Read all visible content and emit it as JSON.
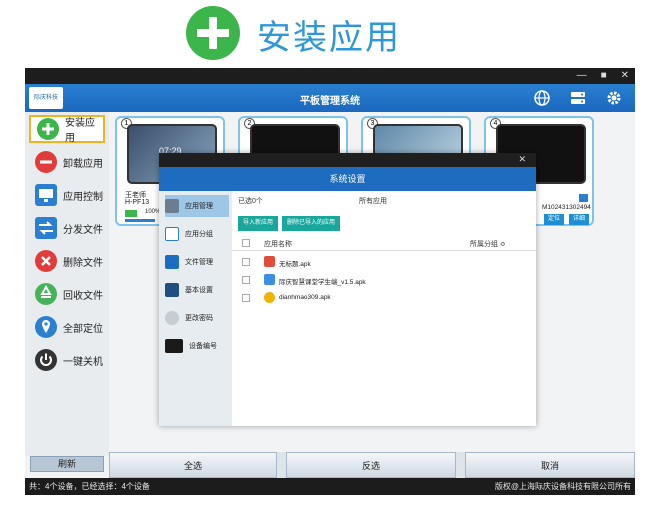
{
  "banner": {
    "title": "安装应用"
  },
  "app": {
    "title": "平板管理系统",
    "icons": [
      "globe-icon",
      "server-icon",
      "gear-icon"
    ]
  },
  "sidebar": {
    "items": [
      {
        "label": "安装应用",
        "icon": "plus-circle-icon",
        "color": "#3cb64a"
      },
      {
        "label": "卸载应用",
        "icon": "minus-circle-icon",
        "color": "#e23b3b"
      },
      {
        "label": "应用控制",
        "icon": "monitor-icon",
        "color": "#2a7fd0"
      },
      {
        "label": "分发文件",
        "icon": "transfer-icon",
        "color": "#2a7fd0"
      },
      {
        "label": "删除文件",
        "icon": "x-circle-icon",
        "color": "#e23b3b"
      },
      {
        "label": "回收文件",
        "icon": "recycle-icon",
        "color": "#46b35a"
      },
      {
        "label": "全部定位",
        "icon": "location-icon",
        "color": "#2a7fd0"
      },
      {
        "label": "一键关机",
        "icon": "power-icon",
        "color": "#333333"
      }
    ],
    "refresh": "刷新"
  },
  "devices": [
    {
      "num": "1",
      "user": "王老师",
      "model": "H-PF13",
      "battery": "100%",
      "time": "07:29"
    },
    {
      "num": "2"
    },
    {
      "num": "3"
    },
    {
      "num": "4",
      "serial": "M102431302494",
      "locate": "定位",
      "detail": "详细"
    }
  ],
  "bottom": {
    "select_all": "全选",
    "invert": "反选",
    "cancel": "取消"
  },
  "status": {
    "left": "共：4个设备，已经选择：4个设备",
    "right": "版权@上海际庆设备科技有限公司所有"
  },
  "dialog": {
    "title": "系统设置",
    "nav": [
      {
        "label": "应用管理",
        "icon": "app-store-icon"
      },
      {
        "label": "应用分组",
        "icon": "group-icon"
      },
      {
        "label": "文件管理",
        "icon": "folder-icon"
      },
      {
        "label": "基本设置",
        "icon": "settings-icon"
      },
      {
        "label": "更改密码",
        "icon": "key-icon"
      },
      {
        "label": "设备编号",
        "icon": "device-number-icon"
      }
    ],
    "selected": "已选0个",
    "all_groups": "所有应用",
    "import_btn": "导入新应用",
    "delete_btn": "删除已导入的应用",
    "col_name": "应用名称",
    "col_group": "所属分组 ≎",
    "apps": [
      {
        "name": "无标题.apk",
        "icon_color": "#e24c3b"
      },
      {
        "name": "际庆智慧课堂学生端_v1.5.apk",
        "icon_color": "#3b8fe2"
      },
      {
        "name": "dianhmao309.apk",
        "icon_color": "#f2b300"
      }
    ]
  }
}
